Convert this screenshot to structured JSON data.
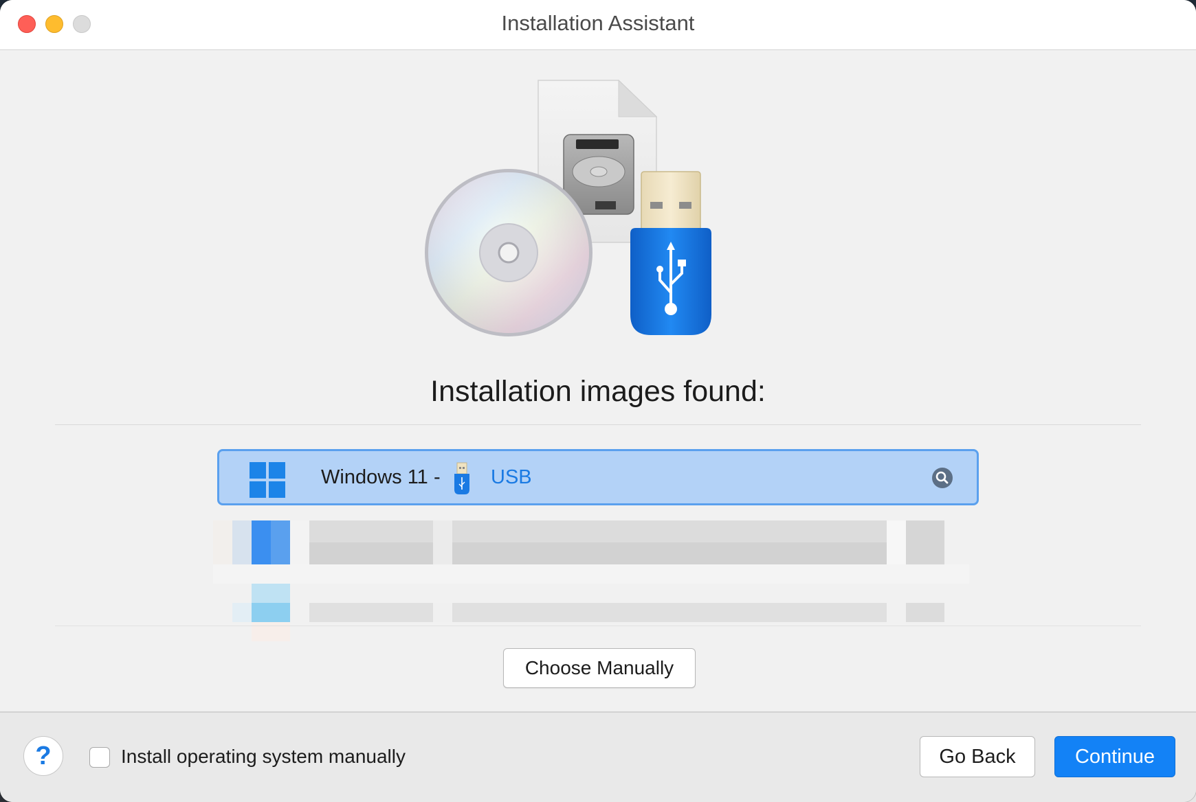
{
  "window": {
    "title": "Installation Assistant"
  },
  "main": {
    "heading": "Installation images found:",
    "images": [
      {
        "os": "Windows 11",
        "separator": "-",
        "source": "USB",
        "selected": true,
        "icon": "windows-logo-icon"
      }
    ],
    "blurred_rows_count": 2,
    "choose_manually_label": "Choose Manually"
  },
  "footer": {
    "help_label": "?",
    "checkbox_label": "Install operating system manually",
    "checkbox_checked": false,
    "go_back_label": "Go Back",
    "continue_label": "Continue"
  },
  "colors": {
    "accent": "#1382f6",
    "selection_fill": "#b3d2f7",
    "selection_border": "#5aa0ee",
    "usb_blue": "#1a7ae3"
  },
  "icons": [
    "close-icon",
    "minimize-icon",
    "zoom-icon",
    "disc-icon",
    "hard-drive-icon",
    "usb-drive-icon",
    "windows-logo-icon",
    "magnifier-icon",
    "help-icon"
  ]
}
